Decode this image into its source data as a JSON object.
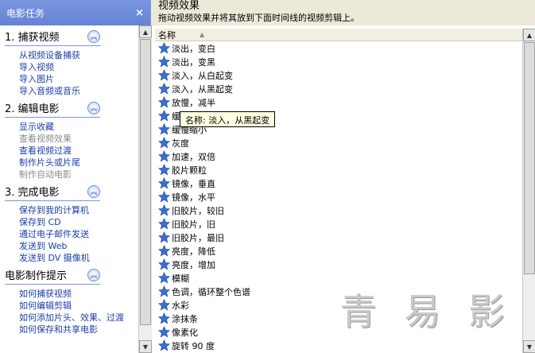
{
  "taskpane": {
    "title": "电影任务",
    "close_glyph": "×",
    "sections": [
      {
        "title": "1. 捕获视频",
        "links": [
          {
            "label": "从视频设备捕获",
            "enabled": true
          },
          {
            "label": "导入视频",
            "enabled": true
          },
          {
            "label": "导入图片",
            "enabled": true
          },
          {
            "label": "导入音频或音乐",
            "enabled": true
          }
        ]
      },
      {
        "title": "2. 编辑电影",
        "links": [
          {
            "label": "显示收藏",
            "enabled": true
          },
          {
            "label": "查看视频效果",
            "enabled": false
          },
          {
            "label": "查看视频过渡",
            "enabled": true
          },
          {
            "label": "制作片头或片尾",
            "enabled": true
          },
          {
            "label": "制作自动电影",
            "enabled": false
          }
        ]
      },
      {
        "title": "3. 完成电影",
        "links": [
          {
            "label": "保存到我的计算机",
            "enabled": true
          },
          {
            "label": "保存到 CD",
            "enabled": true
          },
          {
            "label": "通过电子邮件发送",
            "enabled": true
          },
          {
            "label": "发送到 Web",
            "enabled": true
          },
          {
            "label": "发送到 DV 摄像机",
            "enabled": true
          }
        ]
      },
      {
        "title": "电影制作提示",
        "links": [
          {
            "label": "如何捕获视频",
            "enabled": true
          },
          {
            "label": "如何编辑剪辑",
            "enabled": true
          },
          {
            "label": "如何添加片头、效果、过渡",
            "enabled": true
          },
          {
            "label": "如何保存和共享电影",
            "enabled": true
          }
        ]
      }
    ]
  },
  "content": {
    "title": "视频效果",
    "subtitle": "拖动视频效果并将其放到下面时间线的视频剪辑上。",
    "column_header": "名称",
    "effects": [
      "淡出，变白",
      "淡出，变黑",
      "淡入，从白起变",
      "淡入，从黑起变",
      "放慢，减半",
      "缓",
      "缓慢缩小",
      "灰度",
      "加速，双倍",
      "胶片颗粒",
      "镜像，垂直",
      "镜像，水平",
      "旧胶片，较旧",
      "旧胶片，旧",
      "旧胶片，最旧",
      "亮度，降低",
      "亮度，增加",
      "模糊",
      "色调，循环整个色谱",
      "水彩",
      "涂抹条",
      "像素化",
      "旋转 90 度"
    ],
    "tooltip": "名称: 淡入，从黑起变"
  },
  "watermark": "青 易 影",
  "colors": {
    "link": "#1c3ea8",
    "pane_header": "#7a96df",
    "star": "#3a6fd8"
  }
}
